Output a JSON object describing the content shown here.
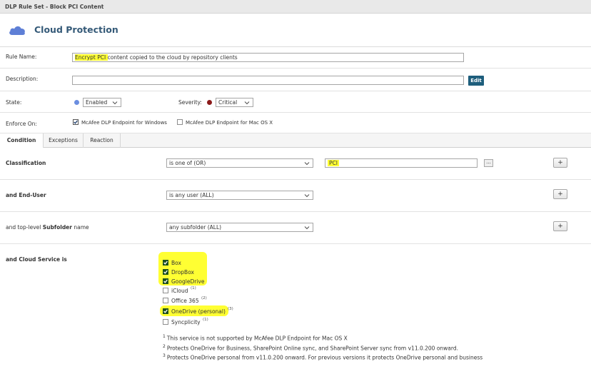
{
  "window": {
    "title": "DLP Rule Set - Block PCI Content"
  },
  "header": {
    "title": "Cloud Protection",
    "icon": "cloud-icon"
  },
  "form": {
    "rule_name_label": "Rule Name:",
    "rule_name_highlight": "Encrypt PCI ",
    "rule_name_rest": "content copied to the cloud by repository clients",
    "description_label": "Description:",
    "description_value": "",
    "edit_label": "Edit",
    "state_label": "State:",
    "state_value": "Enabled",
    "severity_label": "Severity:",
    "severity_value": "Critical",
    "enforce_label": "Enforce On:",
    "enforce_windows": "McAfee DLP Endpoint for Windows",
    "enforce_mac": "McAfee DLP Endpoint for Mac OS X"
  },
  "tabs": [
    "Condition",
    "Exceptions",
    "Reaction"
  ],
  "conditions": {
    "classification_label": "Classification",
    "classification_op": "is one of (OR)",
    "classification_value": "PCI",
    "dots_label": "...",
    "end_user_label": "and End-User",
    "end_user_op": "is any user (ALL)",
    "subfolder_label_pre": "and top-level ",
    "subfolder_label_bold": "Subfolder",
    "subfolder_label_post": " name",
    "subfolder_op": "any subfolder (ALL)",
    "plus_label": "+",
    "cloud_label": "and Cloud Service is"
  },
  "services": [
    {
      "name": "Box",
      "checked": true,
      "highlight": true,
      "sup": ""
    },
    {
      "name": "DropBox",
      "checked": true,
      "highlight": true,
      "sup": ""
    },
    {
      "name": "GoogleDrive",
      "checked": true,
      "highlight": true,
      "sup": ""
    },
    {
      "name": "iCloud",
      "checked": false,
      "highlight": false,
      "sup": "(1)"
    },
    {
      "name": "Office 365",
      "checked": false,
      "highlight": false,
      "sup": "(2)"
    },
    {
      "name": "OneDrive (personal)",
      "checked": true,
      "highlight": true,
      "sup": "(3)"
    },
    {
      "name": "Syncplicity",
      "checked": false,
      "highlight": false,
      "sup": "(1)"
    }
  ],
  "footnotes": [
    {
      "num": "1",
      "text": "This service is not supported by McAfee DLP Endpoint for Mac OS X"
    },
    {
      "num": "2",
      "text": "Protects OneDrive for Business, SharePoint Online sync, and SharePoint Server sync from v11.0.200 onward."
    },
    {
      "num": "3",
      "text": "Protects OneDrive personal from v11.0.200 onward. For previous versions it protects OneDrive personal and business"
    }
  ],
  "colors": {
    "highlight": "#ffff33",
    "accent": "#1e5e7c",
    "enabled_dot": "#6b8ee0",
    "critical_dot": "#8b1a1a",
    "title": "#355a78"
  }
}
